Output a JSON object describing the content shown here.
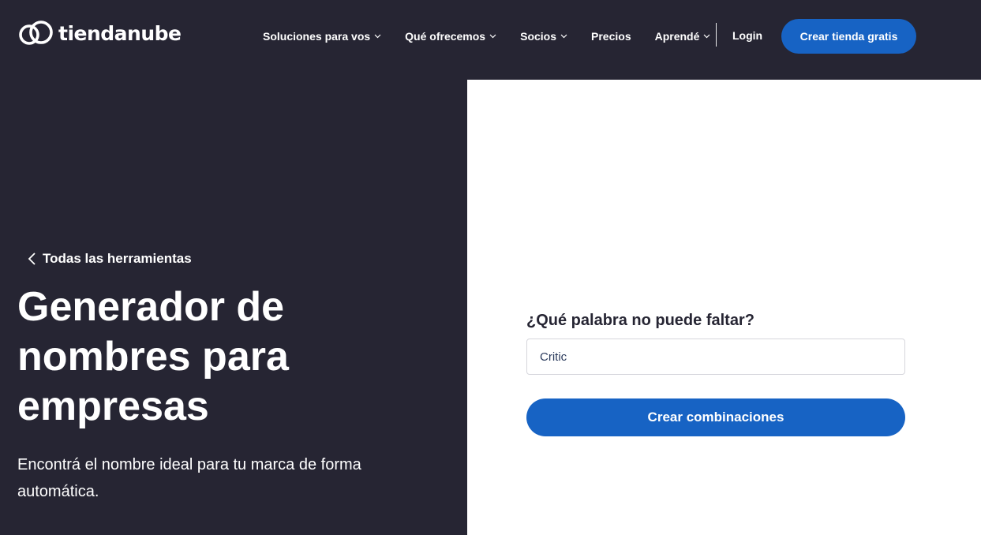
{
  "header": {
    "logo_text": "tiendanube",
    "logo_icon": "cloud-rings-logo",
    "nav_items": [
      {
        "label": "Soluciones para vos",
        "has_dropdown": true
      },
      {
        "label": "Qué ofrecemos",
        "has_dropdown": true
      },
      {
        "label": "Socios",
        "has_dropdown": true
      },
      {
        "label": "Precios",
        "has_dropdown": false
      },
      {
        "label": "Aprendé",
        "has_dropdown": true
      }
    ],
    "login_label": "Login",
    "cta_label": "Crear tienda gratis"
  },
  "hero": {
    "back_link": "Todas las herramientas",
    "title": "Generador de nombres para empresas",
    "subtitle": "Encontrá el nombre ideal para tu marca de forma automática."
  },
  "form": {
    "label": "¿Qué palabra no puede faltar?",
    "input_value": "Critic",
    "submit_label": "Crear combinaciones"
  },
  "colors": {
    "background": "#262533",
    "accent": "#1763c4",
    "panel": "#ffffff"
  }
}
